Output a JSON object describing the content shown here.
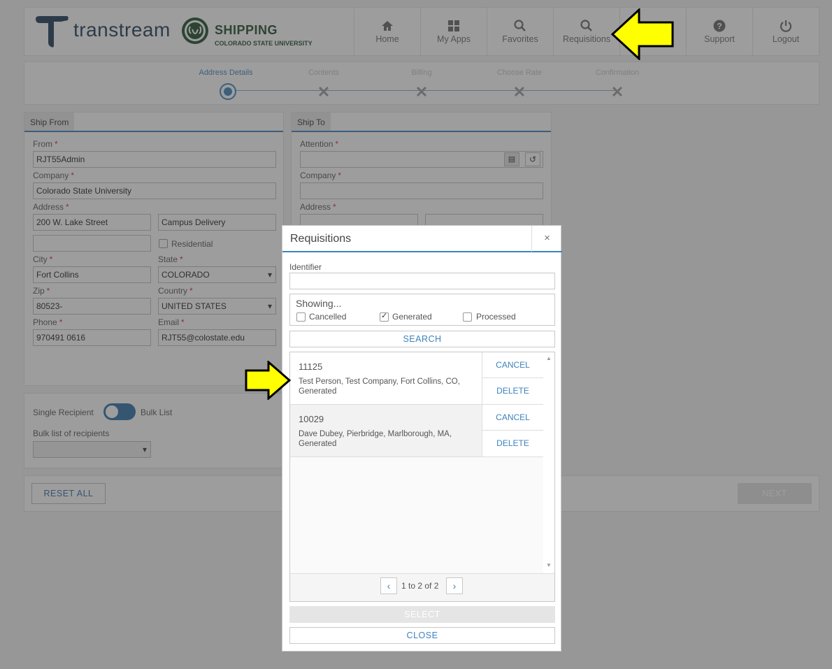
{
  "header": {
    "brand": "transtream",
    "csu_title": "SHIPPING",
    "csu_subtitle": "COLORADO STATE UNIVERSITY",
    "nav": [
      {
        "label": "Home",
        "icon": "home-icon"
      },
      {
        "label": "My Apps",
        "icon": "grid-icon"
      },
      {
        "label": "Favorites",
        "icon": "search-icon"
      },
      {
        "label": "Requisitions",
        "icon": "search-icon"
      },
      {
        "label": "",
        "icon": "none"
      },
      {
        "label": "Support",
        "icon": "question-icon"
      },
      {
        "label": "Logout",
        "icon": "power-icon"
      }
    ]
  },
  "stepper": {
    "steps": [
      "Address Details",
      "Contents",
      "Billing",
      "Choose Rate",
      "Confirmation"
    ]
  },
  "ship_from": {
    "tab": "Ship From",
    "from_label": "From",
    "from_value": "RJT55Admin",
    "company_label": "Company",
    "company_value": "Colorado State University",
    "address_label": "Address",
    "address1": "200 W. Lake Street",
    "address2": "Campus Delivery",
    "address3": "",
    "residential_label": "Residential",
    "city_label": "City",
    "city_value": "Fort Collins",
    "state_label": "State",
    "state_value": "COLORADO",
    "zip_label": "Zip",
    "zip_value": "80523-",
    "country_label": "Country",
    "country_value": "UNITED STATES",
    "phone_label": "Phone",
    "phone_value": "970491 0616",
    "email_label": "Email",
    "email_value": "RJT55@colostate.edu"
  },
  "ship_to": {
    "tab": "Ship To",
    "attention_label": "Attention",
    "company_label": "Company",
    "address_label": "Address"
  },
  "recipients": {
    "single_label": "Single Recipient",
    "bulk_label": "Bulk List",
    "bulk_list_label": "Bulk list of recipients"
  },
  "footer": {
    "reset_label": "RESET ALL",
    "next_label": "NEXT"
  },
  "modal": {
    "title": "Requisitions",
    "close_x": "×",
    "identifier_label": "Identifier",
    "identifier_value": "",
    "showing_label": "Showing...",
    "filters": [
      {
        "label": "Cancelled",
        "checked": false
      },
      {
        "label": "Generated",
        "checked": true
      },
      {
        "label": "Processed",
        "checked": false
      }
    ],
    "search_label": "SEARCH",
    "rows": [
      {
        "id": "11125",
        "desc": "Test Person, Test Company, Fort Collins, CO, Generated",
        "cancel": "CANCEL",
        "delete": "DELETE"
      },
      {
        "id": "10029",
        "desc": "Dave Dubey, Pierbridge, Marlborough, MA, Generated",
        "cancel": "CANCEL",
        "delete": "DELETE"
      }
    ],
    "pager_text": "1 to 2 of 2",
    "pager_prev": "‹",
    "pager_next": "›",
    "select_label": "SELECT",
    "close_label": "CLOSE"
  },
  "colors": {
    "accent": "#3d82bd",
    "highlight_arrow": "#ffff00",
    "csu_green": "#1e4d2b"
  }
}
